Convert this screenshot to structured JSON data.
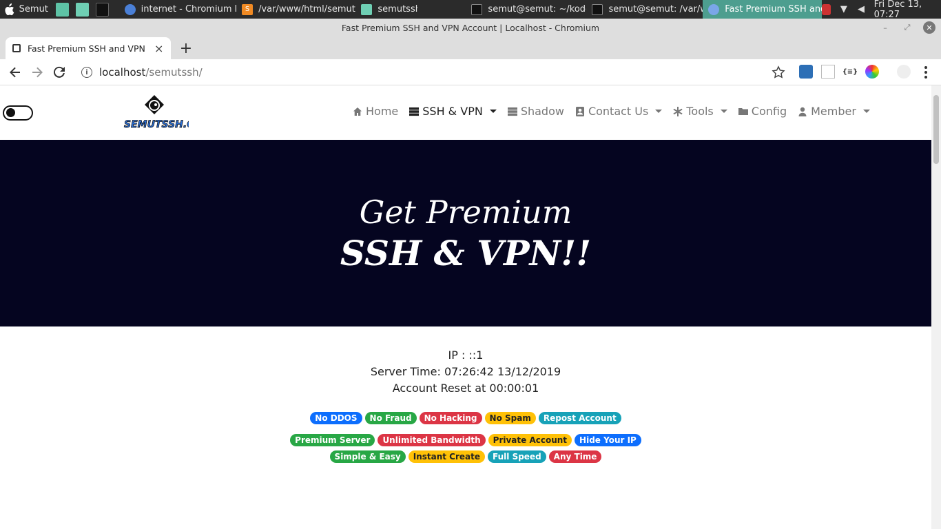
{
  "taskbar": {
    "user": "Semut",
    "tasks": [
      {
        "label": "internet - Chromium b..."
      },
      {
        "label": "/var/www/html/semuts..."
      },
      {
        "label": "semutssh"
      },
      {
        "label": "semut@semut: ~/kode..."
      },
      {
        "label": "semut@semut: /var/w..."
      },
      {
        "label": "Fast Premium SSH and..."
      }
    ],
    "clock": "Fri Dec 13, 07:27"
  },
  "browser": {
    "window_title": "Fast Premium SSH and VPN Account | Localhost - Chromium",
    "tab_title": "Fast Premium SSH and VPN Account | Localhost",
    "url_host": "localhost",
    "url_path": "/semutssh/"
  },
  "site": {
    "logo_text": "SEMUTSSH.COM",
    "menu": [
      {
        "label": "Home"
      },
      {
        "label": "SSH & VPN"
      },
      {
        "label": "Shadow"
      },
      {
        "label": "Contact Us"
      },
      {
        "label": "Tools"
      },
      {
        "label": "Config"
      },
      {
        "label": "Member"
      }
    ],
    "hero": {
      "line1": "Get Premium",
      "line2": "SSH & VPN!!"
    },
    "info": {
      "ip": "IP : ::1",
      "server_time": "Server Time: 07:26:42 13/12/2019",
      "reset": "Account Reset at 00:00:01"
    },
    "badges_row1": [
      "No DDOS",
      "No Fraud",
      "No Hacking",
      "No Spam",
      "Repost Account"
    ],
    "badges_row2": [
      "Premium Server",
      "Unlimited Bandwidth",
      "Private Account",
      "Hide Your IP"
    ],
    "badges_row3": [
      "Simple & Easy",
      "Instant Create",
      "Full Speed",
      "Any Time"
    ]
  },
  "colors": {
    "hero_bg": "#050520",
    "active_task": "#4d9e8f",
    "badge_blue": "#0d6efd",
    "badge_green": "#28a745",
    "badge_red": "#dc3545",
    "badge_yellow": "#ffc107",
    "badge_cyan": "#17a2b8"
  }
}
